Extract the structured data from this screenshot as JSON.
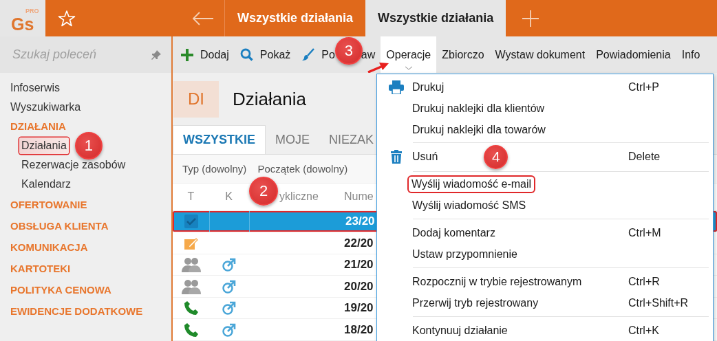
{
  "app": {
    "logo": "Gs",
    "logo_badge": "PRO"
  },
  "tabs": [
    {
      "label": "Wszystkie działania",
      "selected": false
    },
    {
      "label": "Wszystkie działania",
      "selected": true
    }
  ],
  "sidebar": {
    "search": {
      "placeholder": "Szukaj poleceń"
    },
    "items": [
      {
        "label": "Infoserwis",
        "kind": "link",
        "selected": false
      },
      {
        "label": "Wyszukiwarka",
        "kind": "link",
        "selected": false
      },
      {
        "label": "DZIAŁANIA",
        "kind": "section",
        "selected": false,
        "children": [
          {
            "label": "Działania",
            "selected": true,
            "highlighted": true,
            "callout": "1"
          },
          {
            "label": "Rezerwacje zasobów",
            "selected": false,
            "highlighted": false
          },
          {
            "label": "Kalendarz",
            "selected": false,
            "highlighted": false
          }
        ]
      },
      {
        "label": "OFERTOWANIE",
        "kind": "section",
        "selected": false
      },
      {
        "label": "OBSŁUGA KLIENTA",
        "kind": "section",
        "selected": false
      },
      {
        "label": "KOMUNIKACJA",
        "kind": "section",
        "selected": false
      },
      {
        "label": "KARTOTEKI",
        "kind": "section",
        "selected": false
      },
      {
        "label": "POLITYKA CENOWA",
        "kind": "section",
        "selected": false
      },
      {
        "label": "EWIDENCJE DODATKOWE",
        "kind": "section",
        "selected": false
      }
    ]
  },
  "toolbar": [
    {
      "label": "Dodaj",
      "kind": "add",
      "selected": false
    },
    {
      "label": "Pokaż",
      "kind": "view",
      "selected": false
    },
    {
      "label": "Po",
      "label_after": "aw",
      "kind": "edit",
      "selected": false,
      "callout": "3"
    },
    {
      "label": "Operacje",
      "kind": "text",
      "selected": true,
      "dropdown": true
    },
    {
      "label": "Zbiorczo",
      "kind": "text",
      "selected": false
    },
    {
      "label": "Wystaw dokument",
      "kind": "text",
      "selected": false
    },
    {
      "label": "Powiadomienia",
      "kind": "text",
      "selected": false
    },
    {
      "label": "Info",
      "kind": "text",
      "selected": false
    }
  ],
  "page": {
    "badge": "DI",
    "title": "Działania"
  },
  "view_tabs": [
    {
      "label": "WSZYSTKIE",
      "selected": true
    },
    {
      "label": "MOJE",
      "selected": false
    },
    {
      "label": "NIEZAK",
      "selected": false
    }
  ],
  "filters": [
    "Typ (dowolny)",
    "Początek (dowolny)"
  ],
  "table": {
    "columns": [
      {
        "label": "T"
      },
      {
        "label": "K"
      },
      {
        "label": "ykliczne",
        "callout": "2"
      },
      {
        "label": "Nume"
      }
    ],
    "rows": [
      {
        "kind": "task",
        "linked": false,
        "number": "23/20",
        "selected": true,
        "highlighted": true
      },
      {
        "kind": "note",
        "linked": false,
        "number": "22/20",
        "selected": false,
        "highlighted": false
      },
      {
        "kind": "meeting",
        "linked": true,
        "number": "21/20",
        "selected": false,
        "highlighted": false
      },
      {
        "kind": "meeting",
        "linked": true,
        "number": "20/20",
        "selected": false,
        "highlighted": false
      },
      {
        "kind": "call",
        "linked": true,
        "number": "19/20",
        "selected": false,
        "highlighted": false
      },
      {
        "kind": "call",
        "linked": true,
        "number": "18/20",
        "selected": false,
        "highlighted": false
      }
    ]
  },
  "menu": {
    "groups": [
      [
        {
          "label": "Drukuj",
          "shortcut": "Ctrl+P",
          "kind": "print"
        },
        {
          "label": "Drukuj naklejki dla klientów",
          "kind": "plain"
        },
        {
          "label": "Drukuj naklejki dla towarów",
          "kind": "plain"
        }
      ],
      [
        {
          "label": "Usuń",
          "shortcut": "Delete",
          "kind": "delete",
          "callout": "4"
        }
      ],
      [
        {
          "label": "Wyślij wiadomość e-mail",
          "kind": "plain",
          "highlighted": true
        },
        {
          "label": "Wyślij wiadomość SMS",
          "kind": "plain",
          "highlighted": false
        }
      ],
      [
        {
          "label": "Dodaj komentarz",
          "shortcut": "Ctrl+M",
          "kind": "plain"
        },
        {
          "label": "Ustaw przypomnienie",
          "kind": "plain"
        }
      ],
      [
        {
          "label": "Rozpocznij w trybie rejestrowanym",
          "shortcut": "Ctrl+R",
          "kind": "plain"
        },
        {
          "label": "Przerwij tryb rejestrowany",
          "shortcut": "Ctrl+Shift+R",
          "kind": "plain"
        }
      ],
      [
        {
          "label": "Kontynuuj działanie",
          "shortcut": "Ctrl+K",
          "kind": "plain"
        }
      ]
    ]
  }
}
